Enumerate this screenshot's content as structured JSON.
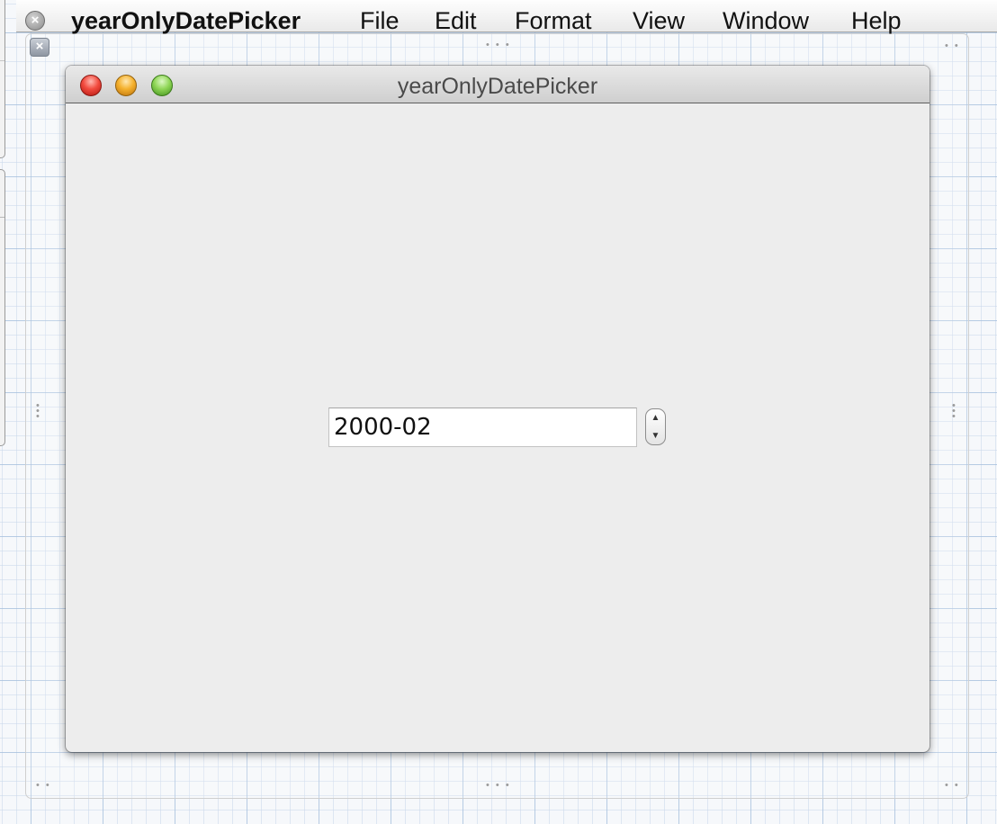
{
  "menubar": {
    "app_name": "yearOnlyDatePicker",
    "items": [
      "File",
      "Edit",
      "Format",
      "View",
      "Window",
      "Help"
    ]
  },
  "window": {
    "title": "yearOnlyDatePicker"
  },
  "date_picker": {
    "value": "2000-02"
  },
  "icons": {
    "menubar_close": "close-circle-icon",
    "canvas_close": "close-square-icon",
    "stepper_up": "chevron-up-icon",
    "stepper_down": "chevron-down-icon"
  },
  "colors": {
    "traffic_close": "#f24b3f",
    "traffic_minimize": "#f5b12d",
    "traffic_zoom": "#8fd656",
    "window_background": "#ededed"
  }
}
